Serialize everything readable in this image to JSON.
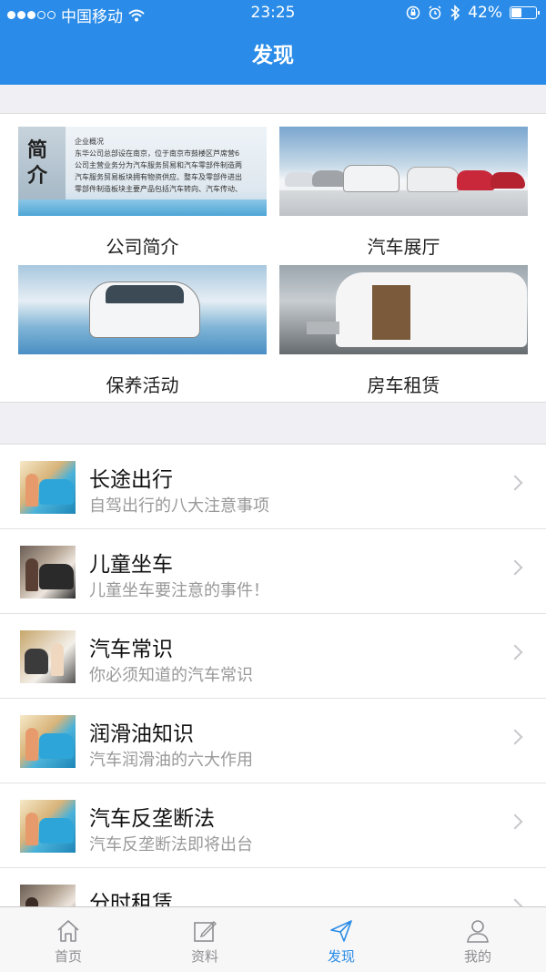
{
  "status_bar": {
    "carrier": "中国移动",
    "time": "23:25",
    "battery": "42%",
    "battery_level": 0.42
  },
  "nav": {
    "title": "发现"
  },
  "grid": [
    {
      "label": "公司简介",
      "image": "company-intro-image"
    },
    {
      "label": "汽车展厅",
      "image": "car-showroom-image"
    },
    {
      "label": "保养活动",
      "image": "maintenance-event-image"
    },
    {
      "label": "房车租赁",
      "image": "rv-rental-image"
    }
  ],
  "intro_image_text": {
    "side": [
      "简",
      "介"
    ],
    "heading": "企业概况",
    "lines": [
      "东华公司总部设在南京，位于南京市鼓楼区芦席营6",
      "公司主营业务分为汽车服务贸易和汽车零部件制造两",
      "汽车服务贸易板块拥有物资供应、整车及零部件进出",
      "零部件制造板块主要产品包括汽车转向、汽车传动、"
    ]
  },
  "list": [
    {
      "title": "长途出行",
      "subtitle": "自驾出行的八大注意事项"
    },
    {
      "title": "儿童坐车",
      "subtitle": "儿童坐车要注意的事件！"
    },
    {
      "title": "汽车常识",
      "subtitle": "你必须知道的汽车常识"
    },
    {
      "title": "润滑油知识",
      "subtitle": "汽车润滑油的六大作用"
    },
    {
      "title": "汽车反垄断法",
      "subtitle": "汽车反垄断法即将出台"
    },
    {
      "title": "分时租赁",
      "subtitle": ""
    }
  ],
  "tabbar": [
    {
      "label": "首页",
      "icon": "home-icon",
      "active": false
    },
    {
      "label": "资料",
      "icon": "edit-icon",
      "active": false
    },
    {
      "label": "发现",
      "icon": "send-icon",
      "active": true
    },
    {
      "label": "我的",
      "icon": "user-icon",
      "active": false
    }
  ],
  "colors": {
    "accent": "#2a8ce8",
    "inactive": "#8e8e93"
  }
}
